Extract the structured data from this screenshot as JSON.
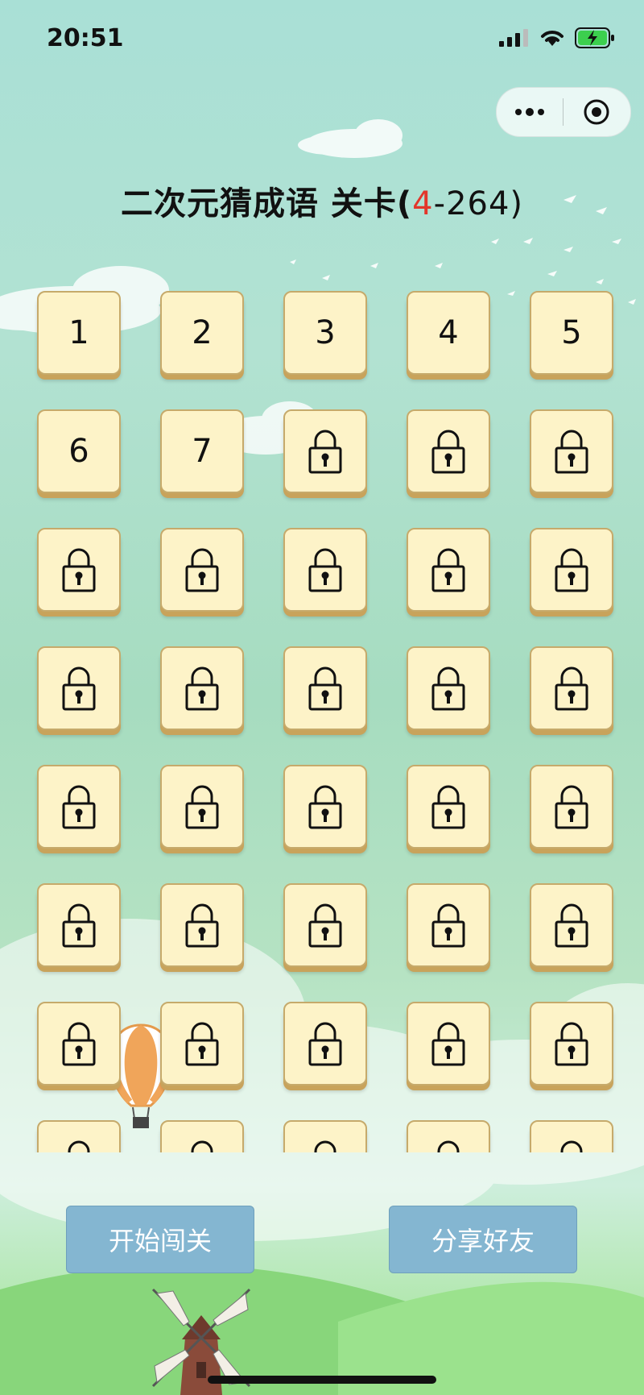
{
  "status": {
    "time": "20:51"
  },
  "title": {
    "main": "二次元猜成语 关卡(",
    "current": "4",
    "dash": "-",
    "total": "264",
    "close": ")"
  },
  "levels": {
    "unlocked": [
      "1",
      "2",
      "3",
      "4",
      "5",
      "6",
      "7"
    ],
    "locked_count": 33
  },
  "buttons": {
    "start": "开始闯关",
    "share": "分享好友"
  },
  "colors": {
    "accent_red": "#e2362b",
    "tile_bg": "#fdf3c8",
    "button_bg": "#84b6d1"
  },
  "icons": [
    "signal-icon",
    "wifi-icon",
    "battery-charging-icon",
    "more-dots-icon",
    "target-icon",
    "lock-icon",
    "hot-air-balloon-icon",
    "windmill-icon"
  ]
}
